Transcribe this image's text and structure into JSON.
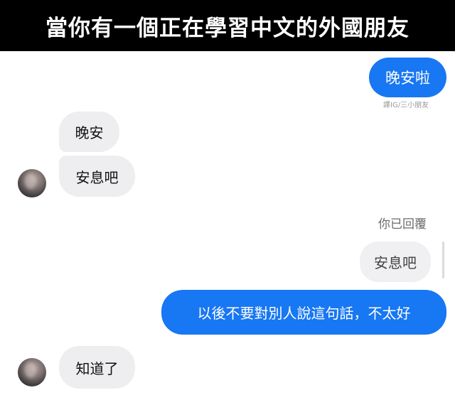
{
  "header": {
    "title": "當你有一個正在學習中文的外國朋友"
  },
  "messages": {
    "m1": {
      "text": "晚安啦"
    },
    "credit": "譯IG/三小朋友",
    "m2": {
      "text": "晚安"
    },
    "m3": {
      "text": "安息吧"
    },
    "replied_label": "你已回覆",
    "m4_quote": {
      "text": "安息吧"
    },
    "m5": {
      "text": "以後不要對別人說這句話，不太好"
    },
    "m6": {
      "text": "知道了"
    }
  },
  "colors": {
    "sent_bubble": "#1877f2",
    "received_bubble": "#eeeef0",
    "header_bg": "#000000"
  }
}
